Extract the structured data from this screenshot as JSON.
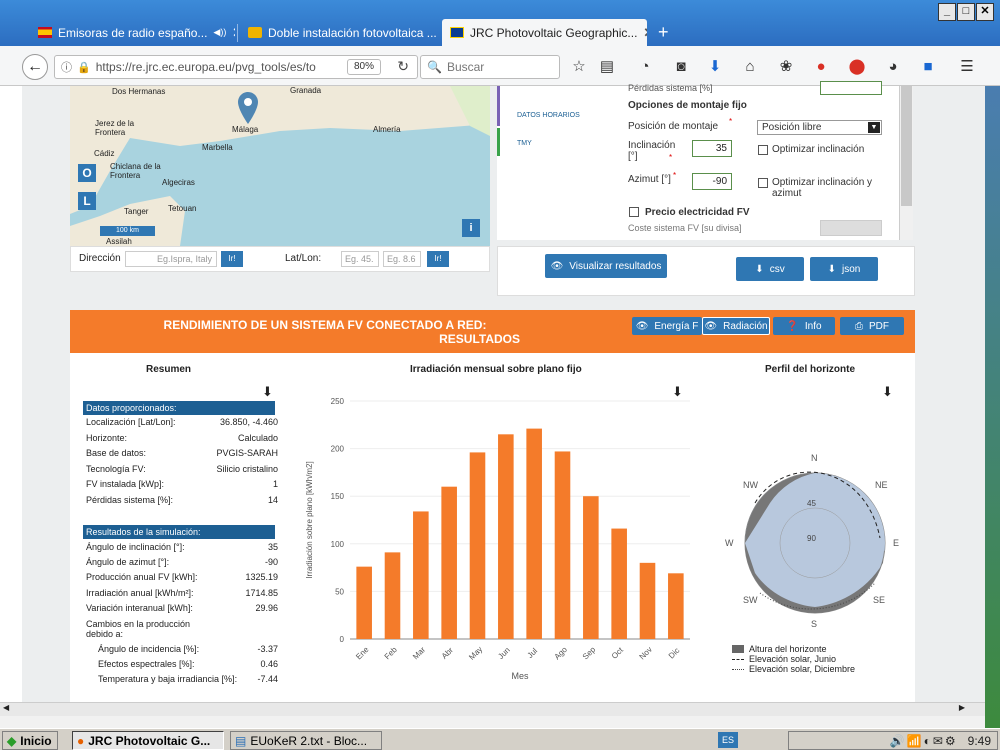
{
  "browser": {
    "tabs": [
      {
        "label": "Emisoras de radio españo...",
        "extra": "◀))"
      },
      {
        "label": "Doble instalación fotovoltaica ..."
      },
      {
        "label": "JRC Photovoltaic Geographic..."
      }
    ],
    "new_tab": "+",
    "url": "https://re.jrc.ec.europa.eu/pvg_tools/es/toc",
    "zoom": "80%",
    "search_placeholder": "Buscar"
  },
  "map": {
    "labels": [
      "Dos Hermanas",
      "Jerez de la Frontera",
      "Málaga",
      "Marbella",
      "Almería",
      "Cádiz",
      "Chiclana de la Frontera",
      "Algeciras",
      "Tanger",
      "Tetouan",
      "Granada",
      "Assilah"
    ],
    "scale": "100 km",
    "ctrl_o": "O",
    "ctrl_l": "L",
    "info": "i"
  },
  "address": {
    "label": "Dirección",
    "placeholder": "Eg.Ispra, Italy",
    "go": "Ir!",
    "latlon_label": "Lat/Lon:",
    "lat_placeholder": "Eg. 45.",
    "lon_placeholder": "Eg. 8.6",
    "go2": "Ir!"
  },
  "mini_tabs": [
    "DATOS HORARIOS",
    "TMY"
  ],
  "form": {
    "perdidas": "Pérdidas sistema [%]",
    "section": "Opciones de montaje fijo",
    "posicion_label": "Posición de montaje",
    "posicion_value": "Posición libre",
    "inclinacion_label": "Inclinación [°]",
    "inclinacion_value": "35",
    "optimizar_incl": "Optimizar inclinación",
    "azimut_label": "Azimut [°]",
    "azimut_value": "-90",
    "optimizar_incl_az": "Optimizar inclinación y azimut",
    "precio": "Precio electricidad FV",
    "coste": "Coste sistema FV [su divisa]",
    "required": "*"
  },
  "actions": {
    "visualizar": "Visualizar resultados",
    "csv": "csv",
    "json": "json"
  },
  "results_header": {
    "title_line1": "RENDIMIENTO DE UN SISTEMA FV CONECTADO A RED:",
    "title_line2": "RESULTADOS",
    "btn_energia": "Energía F",
    "btn_radiacion": "Radiación",
    "btn_info": "Info",
    "btn_pdf": "PDF"
  },
  "summary": {
    "title": "Resumen",
    "provided_header": "Datos proporcionados:",
    "provided": [
      {
        "k": "Localización [Lat/Lon]:",
        "v": "36.850, -4.460"
      },
      {
        "k": "Horizonte:",
        "v": "Calculado"
      },
      {
        "k": "Base de datos:",
        "v": "PVGIS-SARAH"
      },
      {
        "k": "Tecnología FV:",
        "v": "Silicio cristalino"
      },
      {
        "k": "FV instalada [kWp]:",
        "v": "1"
      },
      {
        "k": "Pérdidas sistema [%]:",
        "v": "14"
      }
    ],
    "sim_header": "Resultados de la simulación:",
    "sim": [
      {
        "k": "Ángulo de inclinación [°]:",
        "v": "35"
      },
      {
        "k": "Ángulo de azimut [°]:",
        "v": "-90"
      },
      {
        "k": "Producción anual FV [kWh]:",
        "v": "1325.19"
      },
      {
        "k": "Irradiación anual [kWh/m²]:",
        "v": "1714.85"
      },
      {
        "k": "Variación interanual [kWh]:",
        "v": "29.96"
      }
    ],
    "cambios": "Cambios en la producción debido a:",
    "cambios_rows": [
      {
        "k": "Ángulo de incidencia [%]:",
        "v": "-3.37"
      },
      {
        "k": "Efectos espectrales [%]:",
        "v": "0.46"
      },
      {
        "k": "Temperatura y baja irradiancia [%]:",
        "v": "-7.44"
      }
    ]
  },
  "chart_data": {
    "type": "bar",
    "title": "Irradiación mensual sobre plano fijo",
    "xlabel": "Mes",
    "ylabel": "Irradiación sobre plano [kWh/m2]",
    "categories": [
      "Ene",
      "Feb",
      "Mar",
      "Abr",
      "May",
      "Jun",
      "Jul",
      "Ago",
      "Sep",
      "Oct",
      "Nov",
      "Dic"
    ],
    "values": [
      76,
      91,
      134,
      160,
      196,
      215,
      221,
      197,
      150,
      116,
      80,
      69
    ],
    "yticks": [
      0,
      50,
      100,
      150,
      200,
      250
    ],
    "ylim": [
      0,
      250
    ],
    "color": "#f47b2a"
  },
  "horizon": {
    "title": "Perfil del horizonte",
    "compass": {
      "n": "N",
      "ne": "NE",
      "e": "E",
      "se": "SE",
      "s": "S",
      "sw": "SW",
      "w": "W",
      "nw": "NW"
    },
    "rings": [
      "45",
      "90"
    ],
    "legend": [
      "Altura del horizonte",
      "Elevación solar, Junio",
      "Elevación solar, Diciembre"
    ]
  },
  "taskbar": {
    "start": "Inicio",
    "items": [
      "JRC Photovoltaic G...",
      "EUoKeR 2.txt - Bloc..."
    ],
    "lang": "ES",
    "clock": "9:49"
  }
}
